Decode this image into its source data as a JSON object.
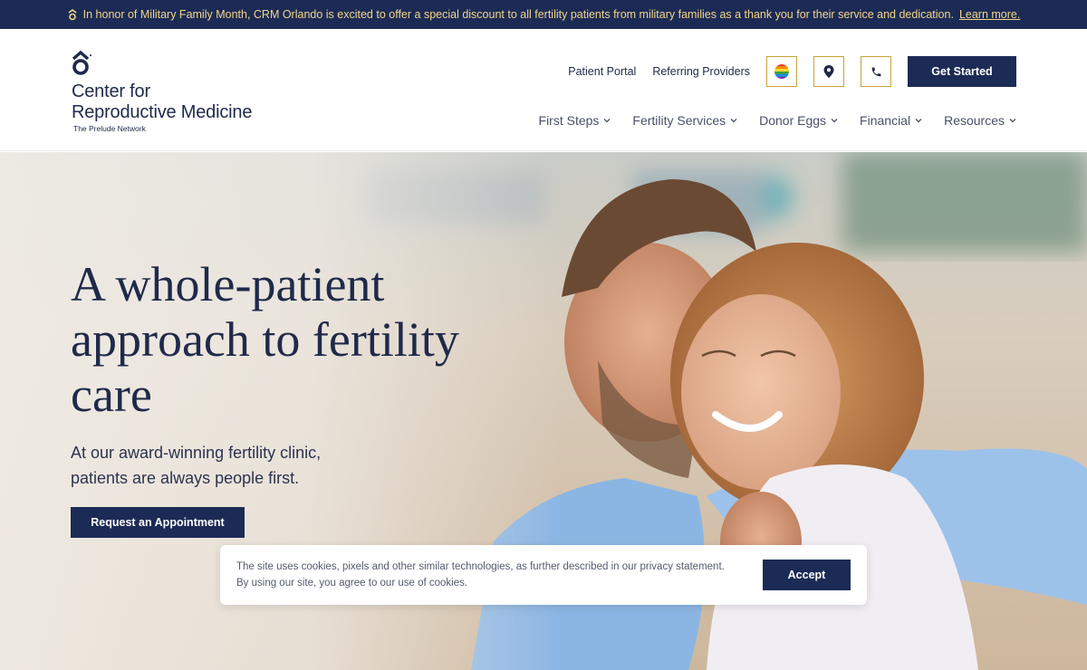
{
  "announcement": {
    "text": "In honor of Military Family Month, CRM Orlando is excited to offer a special discount to all fertility patients from military families as a thank you for their service and dedication.",
    "link": "Learn more.",
    "icon": "logo-mark-icon"
  },
  "logo": {
    "line1": "Center for",
    "line2": "Reproductive Medicine",
    "tagline": "The Prelude Network"
  },
  "utility": {
    "links": [
      "Patient Portal",
      "Referring Providers"
    ],
    "icons": [
      "pride-icon",
      "location-pin-icon",
      "phone-icon"
    ],
    "cta": "Get Started"
  },
  "nav": {
    "items": [
      "First Steps",
      "Fertility Services",
      "Donor Eggs",
      "Financial",
      "Resources"
    ]
  },
  "hero": {
    "title": "A whole-patient approach to fertility care",
    "subtitle": "At our award-winning fertility clinic, patients are always people first.",
    "cta": "Request an Appointment"
  },
  "cookie": {
    "line1": "The site uses cookies, pixels and other similar technologies, as further described in our privacy statement.",
    "line2": "By using our site, you agree to our use of cookies.",
    "accept": "Accept"
  },
  "colors": {
    "navy": "#1c2b55",
    "gold": "#c9a23a",
    "announcement_text": "#f3d58a"
  }
}
